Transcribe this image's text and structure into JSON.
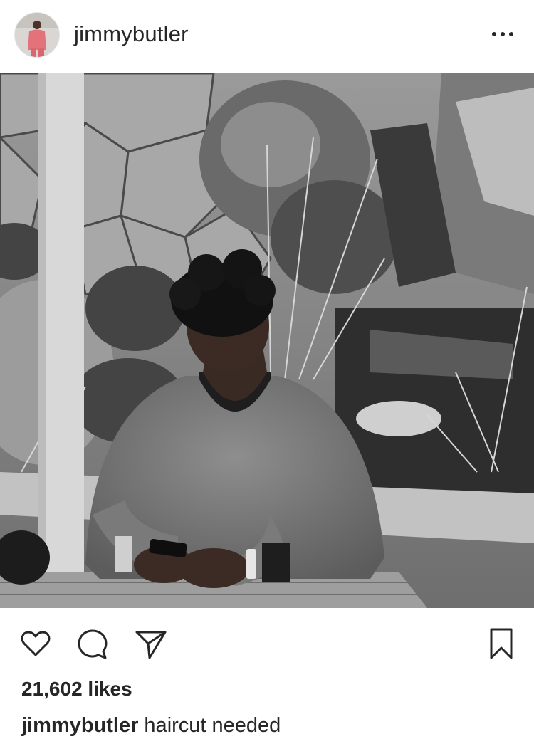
{
  "post": {
    "username": "jimmybutler",
    "likes": "21,602 likes",
    "caption_user": "jimmybutler",
    "caption_text": " haircut needed"
  },
  "icons": {
    "more": "more-options-icon",
    "like": "heart-icon",
    "comment": "comment-bubble-icon",
    "share": "paper-plane-icon",
    "save": "bookmark-icon"
  },
  "colors": {
    "text": "#262626",
    "background": "#ffffff",
    "avatar_accent": "#e2737a"
  }
}
